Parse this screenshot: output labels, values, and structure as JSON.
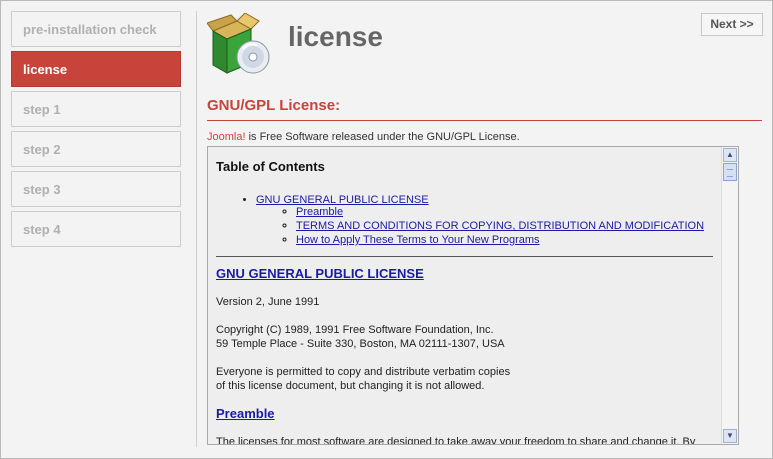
{
  "sidebar": {
    "items": [
      {
        "label": "pre-installation check"
      },
      {
        "label": "license"
      },
      {
        "label": "step 1"
      },
      {
        "label": "step 2"
      },
      {
        "label": "step 3"
      },
      {
        "label": "step 4"
      }
    ],
    "active_index": 1
  },
  "header": {
    "title": "license",
    "icon": "package-disc-icon",
    "next_label": "Next >>"
  },
  "section": {
    "heading": "GNU/GPL License:",
    "intro_brand": "Joomla!",
    "intro_text": " is Free Software released under the GNU/GPL License."
  },
  "license": {
    "toc_heading": "Table of Contents",
    "toc_main": "GNU GENERAL PUBLIC LICENSE",
    "toc_sub": [
      "Preamble",
      "TERMS AND CONDITIONS FOR COPYING, DISTRIBUTION AND MODIFICATION",
      "How to Apply These Terms to Your New Programs"
    ],
    "gpl_title": "GNU GENERAL PUBLIC LICENSE",
    "version": "Version 2, June 1991",
    "copyright_line1": "Copyright (C) 1989, 1991 Free Software Foundation, Inc.",
    "copyright_line2": "59 Temple Place - Suite 330, Boston, MA  02111-1307, USA",
    "permission_line1": "Everyone is permitted to copy and distribute verbatim copies",
    "permission_line2": "of this license document, but changing it is not allowed.",
    "preamble_title": "Preamble",
    "preamble_text": "The licenses for most software are designed to take away your freedom to share and change it. By"
  },
  "colors": {
    "accent": "#c8443a",
    "link": "#1a1aa6"
  }
}
